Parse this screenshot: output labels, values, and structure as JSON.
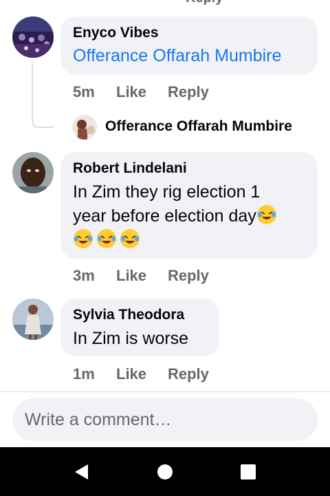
{
  "top_cutoff": "Reply",
  "comments": [
    {
      "author": "Enyco Vibes",
      "mention": "Offerance Offarah Mumbire",
      "time": "5m",
      "like": "Like",
      "reply": "Reply"
    },
    {
      "author": "Robert Lindelani",
      "text_line1": "In Zim they rig election 1",
      "text_line2": "year before election day",
      "emoji": "rolling-on-floor-laughing-emoji",
      "time": "3m",
      "like": "Like",
      "reply": "Reply"
    },
    {
      "author": "Sylvia Theodora",
      "text": "In Zim is worse",
      "time": "1m",
      "like": "Like",
      "reply": "Reply"
    }
  ],
  "reply_preview": {
    "name": "Offerance Offarah Mumbire"
  },
  "composer": {
    "placeholder": "Write a comment…"
  },
  "colors": {
    "bubble": "#f0f2f5",
    "meta": "#65676b",
    "link": "#1877f2",
    "navbar": "#000000"
  },
  "nav": {
    "back": "back-icon",
    "home": "home-icon",
    "recents": "recents-icon"
  }
}
